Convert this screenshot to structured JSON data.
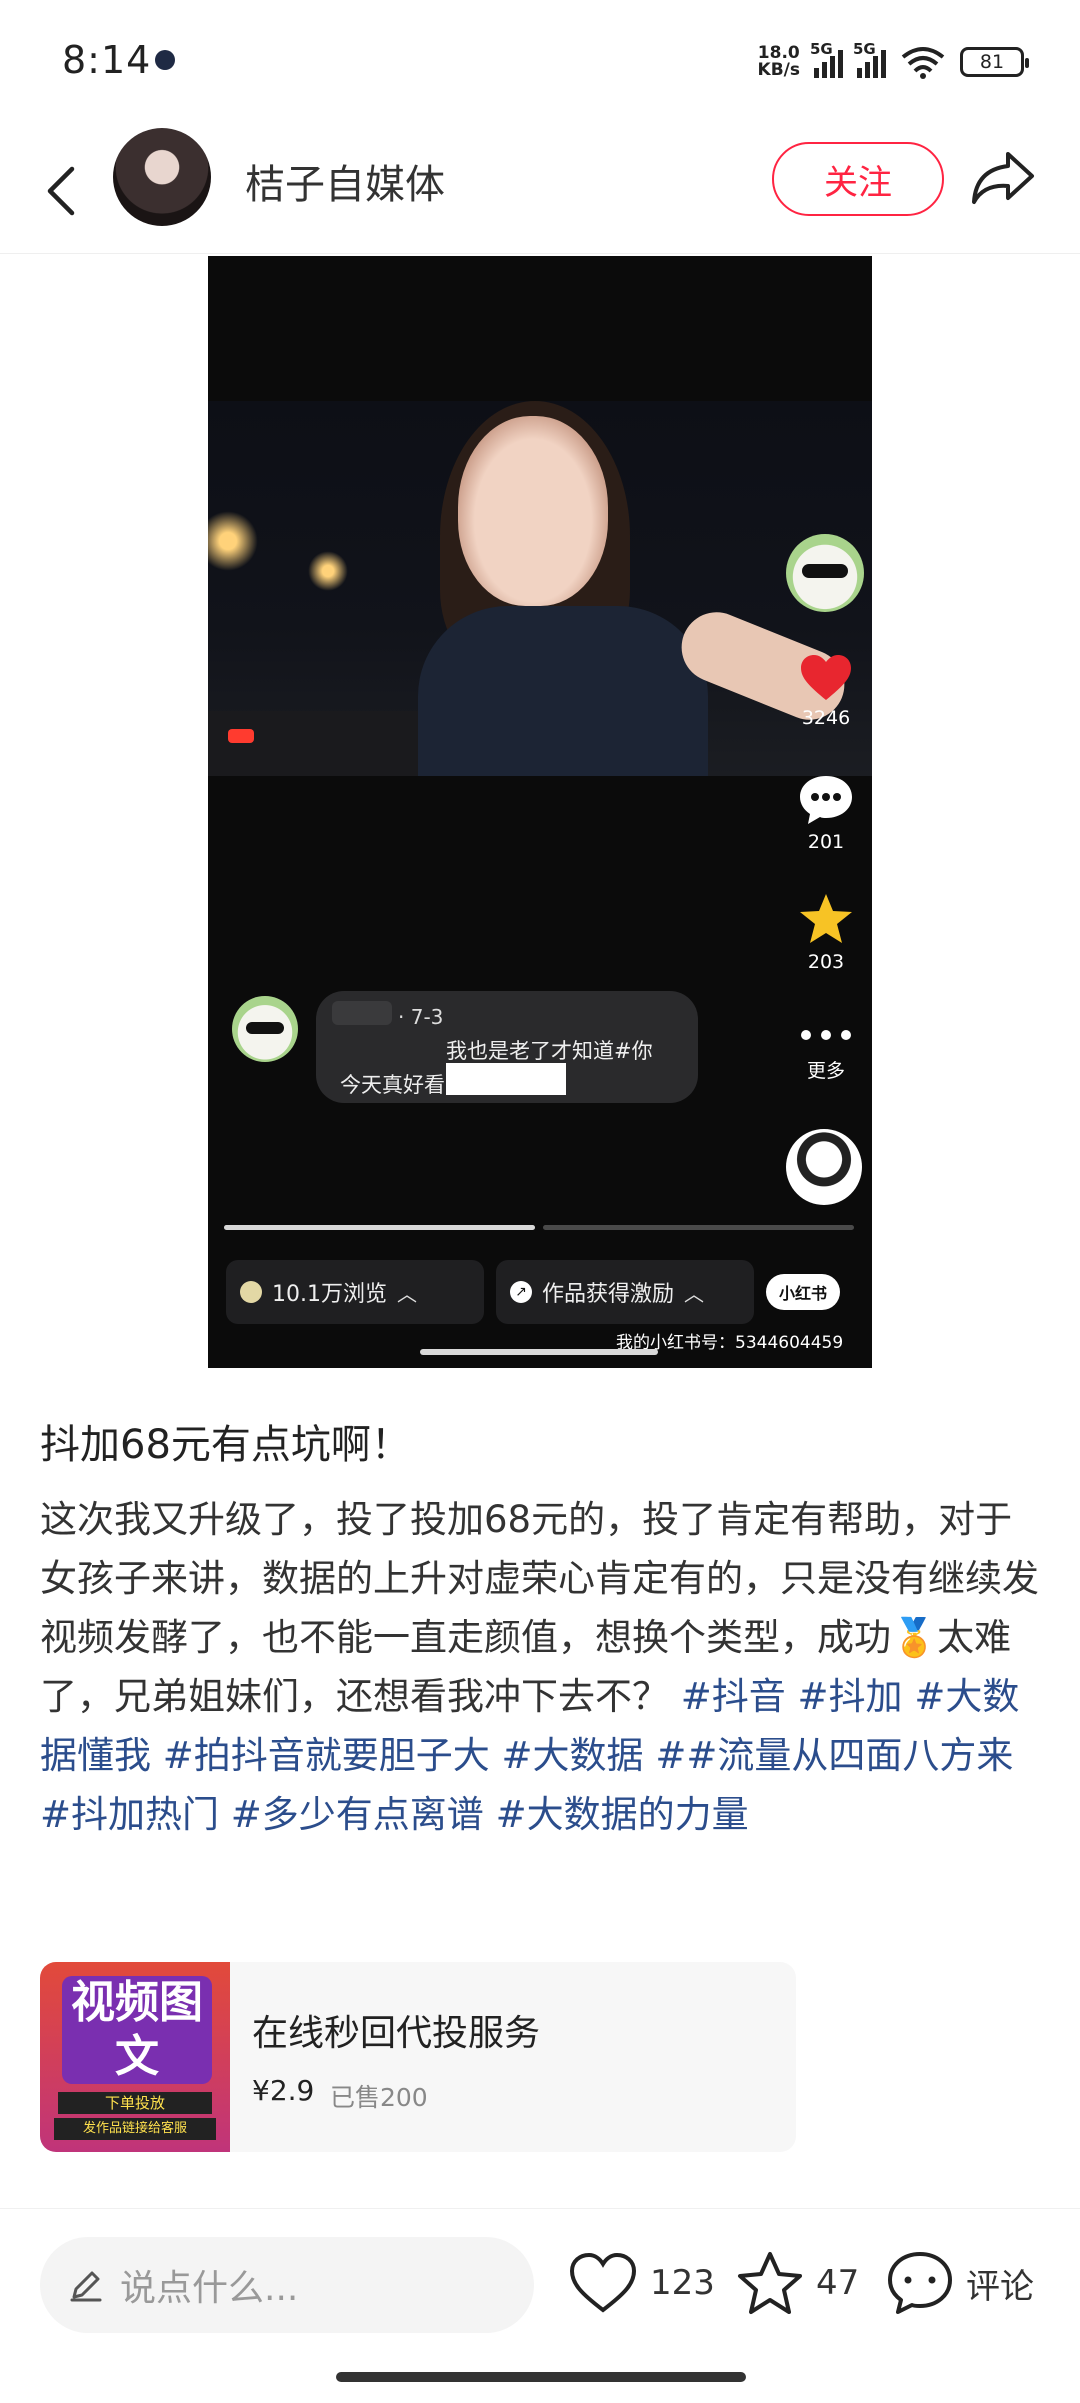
{
  "status_bar": {
    "time": "8:14",
    "net_speed_top": "18.0",
    "net_speed_bottom": "KB/s",
    "sig1_label": "5G",
    "sig2_label": "5G",
    "battery": "81"
  },
  "header": {
    "author_name": "桔子自媒体",
    "follow_label": "关注"
  },
  "media": {
    "likes": "3246",
    "comments": "201",
    "stars": "203",
    "more_label": "更多",
    "comment_date": "· 7-3",
    "comment_line1": "我也是老了才知道#你",
    "comment_line2": "今天真好看",
    "progress": [
      1.0,
      0.0
    ],
    "views_label": "10.1万浏览",
    "reward_label": "作品获得激励",
    "logo_text": "小红书",
    "xhs_id": "我的小红书号：5344604459"
  },
  "post": {
    "title": "抖加68元有点坑啊！",
    "body_text": "这次我又升级了，投了投加68元的，投了肯定有帮助，对于女孩子来讲，数据的上升对虚荣心肯定有的，只是没有继续发视频发酵了，也不能一直走颜值，想换个类型，成功🏅太难了，兄弟姐妹们，还想看我冲下去不？",
    "tags": [
      "#抖音",
      "#抖加",
      "#大数据懂我",
      "#拍抖音就要胆子大",
      "#大数据",
      "##流量从四面八方来",
      "#抖加热门",
      "#多少有点离谱",
      "#大数据的力量"
    ]
  },
  "product": {
    "thumb_big": "视频图文",
    "thumb_strip1": "下单投放",
    "thumb_strip2": "发作品链接给客服",
    "name": "在线秒回代投服务",
    "price": "¥2.9",
    "sold": "已售200"
  },
  "bottom_bar": {
    "input_placeholder": "说点什么...",
    "likes": "123",
    "stars": "47",
    "comment_label": "评论"
  }
}
